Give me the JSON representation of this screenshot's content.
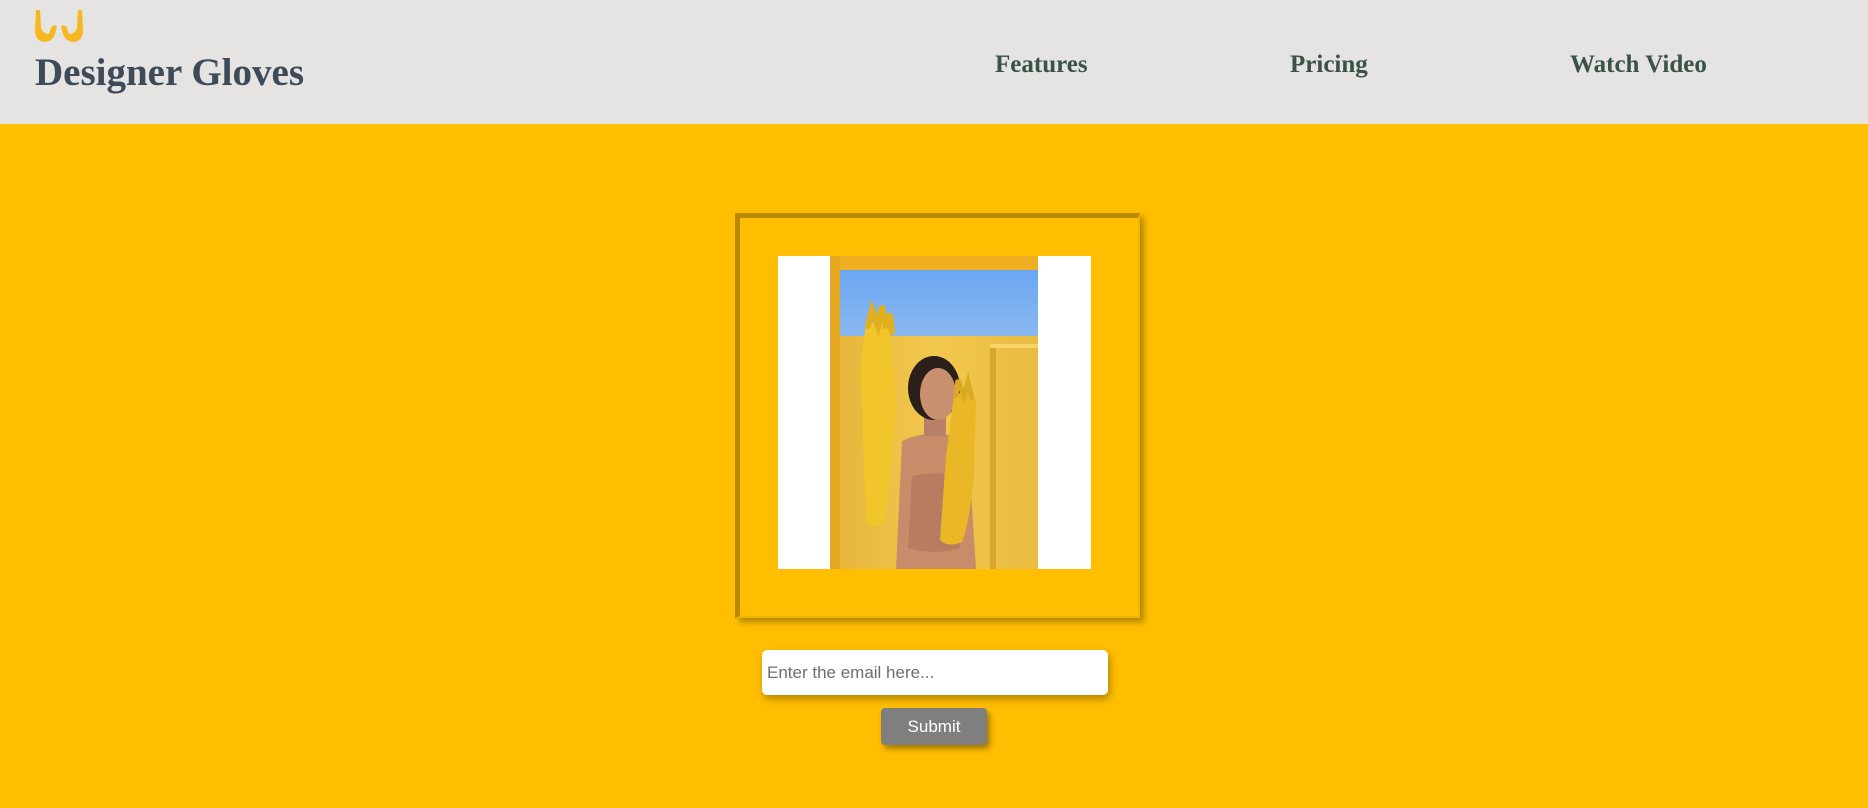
{
  "header": {
    "brand": "Designer Gloves",
    "logo_icon": "hands-icon",
    "nav": {
      "features": "Features",
      "pricing": "Pricing",
      "watch_video": "Watch Video"
    }
  },
  "hero": {
    "image_icon": "woman-wearing-yellow-gloves-photo"
  },
  "form": {
    "email_placeholder": "Enter the email here...",
    "email_value": "",
    "submit_label": "Submit"
  },
  "colors": {
    "page_background": "#ffbe00",
    "header_background": "#e5e4e2",
    "brand_text": "#3d4a58",
    "nav_text": "#395345",
    "logo": "#f5b820",
    "button": "#7f7f7f"
  }
}
